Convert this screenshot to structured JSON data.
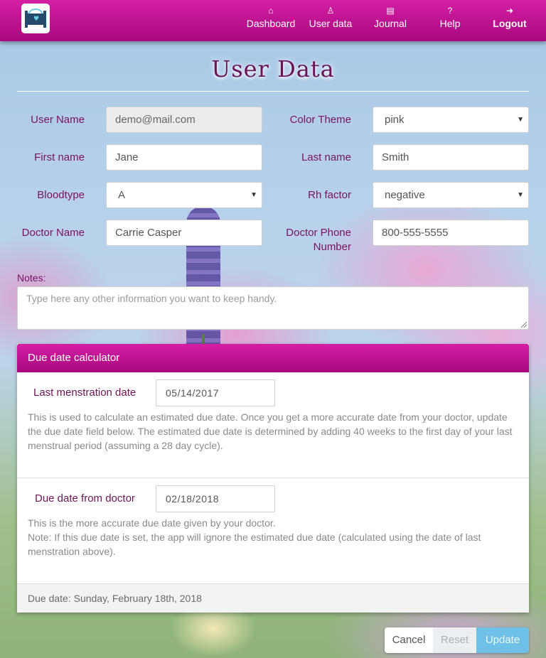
{
  "nav": {
    "items": [
      {
        "label": "Dashboard",
        "icon": "home-icon"
      },
      {
        "label": "User data",
        "icon": "user-icon"
      },
      {
        "label": "Journal",
        "icon": "book-icon"
      },
      {
        "label": "Help",
        "icon": "question-icon"
      },
      {
        "label": "Logout",
        "icon": "logout-icon"
      }
    ],
    "glyphs": [
      "⌂",
      "♙",
      "▤",
      "?",
      "➜"
    ]
  },
  "page": {
    "title": "User Data"
  },
  "form": {
    "user_name": {
      "label": "User Name",
      "value": "demo@mail.com"
    },
    "color_theme": {
      "label": "Color Theme",
      "value": "pink"
    },
    "first_name": {
      "label": "First name",
      "value": "Jane"
    },
    "last_name": {
      "label": "Last name",
      "value": "Smith"
    },
    "bloodtype": {
      "label": "Bloodtype",
      "value": "A"
    },
    "rh_factor": {
      "label": "Rh factor",
      "value": "negative"
    },
    "doctor_name": {
      "label": "Doctor Name",
      "value": "Carrie Casper"
    },
    "doctor_phone": {
      "label_line1": "Doctor Phone",
      "label_line2": "Number",
      "value": "800-555-5555"
    },
    "notes": {
      "label": "Notes:",
      "placeholder": "Type here any other information you want to keep handy."
    }
  },
  "calculator": {
    "title": "Due date calculator",
    "lmp": {
      "label": "Last menstration date",
      "value": "05/14/2017",
      "help": "This is used to calculate an estimated due date. Once you get a more accurate date from your doctor, update the due date field below. The estimated due date is determined by adding 40 weeks to the first day of your last menstrual period (assuming a 28 day cycle)."
    },
    "doctor_due": {
      "label": "Due date from doctor",
      "value": "02/18/2018",
      "help_line1": "This is the more accurate due date given by your doctor.",
      "help_line2": "Note: If this due date is set, the app will ignore the estimated due date (calculated using the date of last menstration above)."
    },
    "result": "Due date: Sunday, February 18th, 2018"
  },
  "buttons": {
    "cancel": "Cancel",
    "reset": "Reset",
    "update": "Update"
  },
  "colors": {
    "brand": "#c0128f",
    "label": "#7c1060",
    "update": "#6fc0e6"
  }
}
